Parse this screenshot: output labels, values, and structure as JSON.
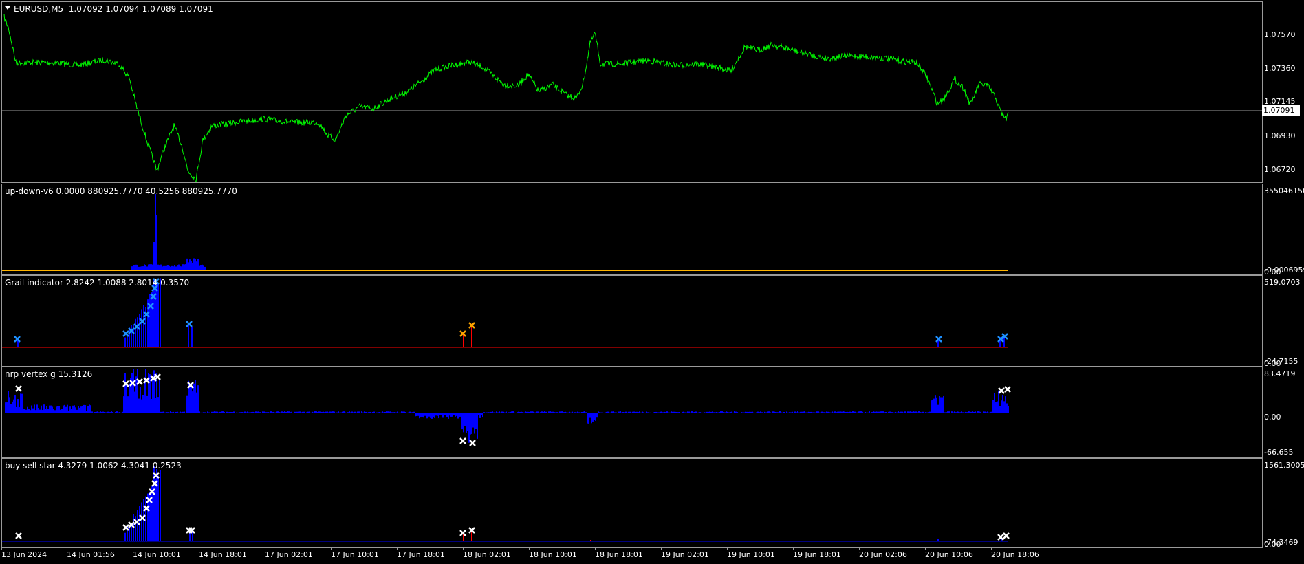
{
  "colors": {
    "price": "#00ff00",
    "blue": "#0000ff",
    "lightblue": "#1e90ff",
    "red": "#ff0000",
    "orange": "#ffa500",
    "yellow": "#ffb400",
    "grid": "#9a9a9a",
    "white": "#ffffff"
  },
  "main": {
    "symbol": "EURUSD,M5",
    "ohlc": "1.07092 1.07094 1.07089 1.07091",
    "price_labels": [
      "1.07570",
      "1.07360",
      "1.07145",
      "1.06930",
      "1.06720"
    ],
    "current_price": "1.07091",
    "menu_icon": "triangle-down-icon"
  },
  "subwindows": [
    {
      "title": "up-down-v6 0.0000 880925.7770 40.5256 880925.7770",
      "labels": [
        "355046150",
        "-0.0006959",
        "0.00"
      ]
    },
    {
      "title": "Grail indicator 2.8242 1.0088 2.8014 0.3570",
      "labels": [
        "519.0703",
        "-24.7155",
        "0.00"
      ]
    },
    {
      "title": "nrp vertex g 15.3126",
      "labels": [
        "83.4719",
        "0.00",
        "-66.655"
      ]
    },
    {
      "title": "buy sell star 4.3279 1.0062 4.3041 0.2523",
      "labels": [
        "1561.3005",
        "-74.3469",
        "0.00"
      ]
    }
  ],
  "time_axis": [
    "13 Jun 2024",
    "14 Jun 01:56",
    "14 Jun 10:01",
    "14 Jun 18:01",
    "17 Jun 02:01",
    "17 Jun 10:01",
    "17 Jun 18:01",
    "18 Jun 02:01",
    "18 Jun 10:01",
    "18 Jun 18:01",
    "19 Jun 02:01",
    "19 Jun 10:01",
    "19 Jun 18:01",
    "20 Jun 02:06",
    "20 Jun 10:06",
    "20 Jun 18:06"
  ]
}
